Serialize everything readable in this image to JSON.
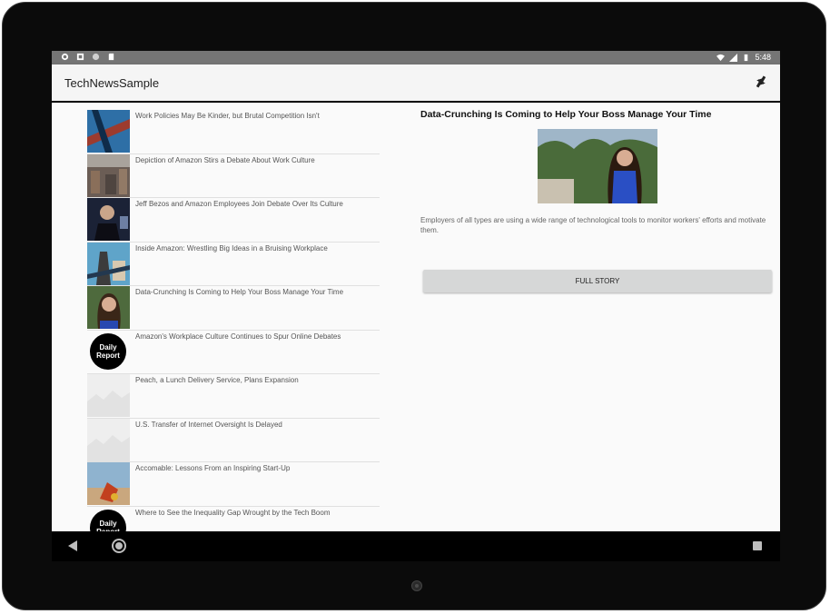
{
  "status_bar": {
    "time": "5:48"
  },
  "app_bar": {
    "title": "TechNewsSample"
  },
  "articles": [
    {
      "headline": "Work Policies May Be Kinder, but Brutal Competition Isn't"
    },
    {
      "headline": "Depiction of Amazon Stirs a Debate About Work Culture"
    },
    {
      "headline": "Jeff Bezos and Amazon Employees Join Debate Over Its Culture"
    },
    {
      "headline": "Inside Amazon: Wrestling Big Ideas in a Bruising Workplace"
    },
    {
      "headline": "Data-Crunching Is Coming to Help Your Boss Manage Your Time"
    },
    {
      "headline": "Amazon's Workplace Culture Continues to Spur Online Debates",
      "thumb_text": "Daily Report"
    },
    {
      "headline": "Peach, a Lunch Delivery Service, Plans Expansion"
    },
    {
      "headline": "U.S. Transfer of Internet Oversight Is Delayed"
    },
    {
      "headline": "Accomable: Lessons From an Inspiring Start-Up"
    },
    {
      "headline": "Where to See the Inequality Gap Wrought by the Tech Boom",
      "thumb_text": "Daily Report"
    }
  ],
  "detail": {
    "headline": "Data-Crunching Is Coming to Help Your Boss Manage Your Time",
    "summary": "Employers of all types are using a wide range of technological tools to monitor workers' efforts and motivate them.",
    "button_label": "FULL STORY"
  },
  "colors": {
    "status_bar": "#757575",
    "app_bar": "#f5f5f5",
    "button": "#d6d7d7"
  }
}
